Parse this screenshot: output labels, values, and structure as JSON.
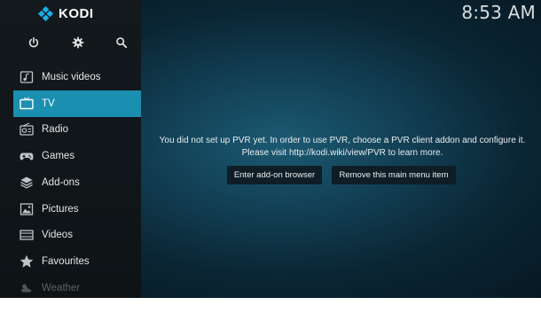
{
  "app": {
    "name": "KODI"
  },
  "clock": {
    "time": "8:53 AM"
  },
  "top_icons": [
    "power-icon",
    "settings-icon",
    "search-icon"
  ],
  "menu": {
    "items": [
      {
        "label": "Music videos",
        "icon": "music-video-icon"
      },
      {
        "label": "TV",
        "icon": "tv-icon",
        "active": true
      },
      {
        "label": "Radio",
        "icon": "radio-icon"
      },
      {
        "label": "Games",
        "icon": "gamepad-icon"
      },
      {
        "label": "Add-ons",
        "icon": "addons-icon"
      },
      {
        "label": "Pictures",
        "icon": "pictures-icon"
      },
      {
        "label": "Videos",
        "icon": "videos-icon"
      },
      {
        "label": "Favourites",
        "icon": "star-icon"
      },
      {
        "label": "Weather",
        "icon": "weather-icon"
      }
    ]
  },
  "message": {
    "line1": "You did not set up PVR yet. In order to use PVR, choose a PVR client addon and configure it.",
    "line2": "Please visit http://kodi.wiki/view/PVR to learn more."
  },
  "buttons": {
    "addon_browser": "Enter add-on browser",
    "remove_item": "Remove this main menu item"
  },
  "colors": {
    "accent": "#1a8fb0",
    "sidebar": "#11171a",
    "background": "#0d3446"
  }
}
